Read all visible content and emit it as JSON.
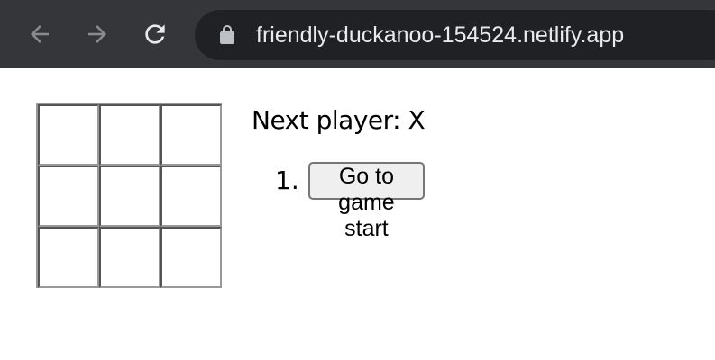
{
  "browser": {
    "back_icon": "arrow-left-icon",
    "forward_icon": "arrow-right-icon",
    "reload_icon": "reload-icon",
    "lock_icon": "lock-icon",
    "url": "friendly-duckanoo-154524.netlify.app",
    "chrome_color": "#35363a",
    "omnibox_color": "#202124"
  },
  "game": {
    "board": {
      "squares": [
        "",
        "",
        "",
        "",
        "",
        "",
        "",
        "",
        ""
      ]
    },
    "status": "Next player: X",
    "moves": [
      {
        "number": "1.",
        "label": "Go to game start"
      }
    ]
  }
}
